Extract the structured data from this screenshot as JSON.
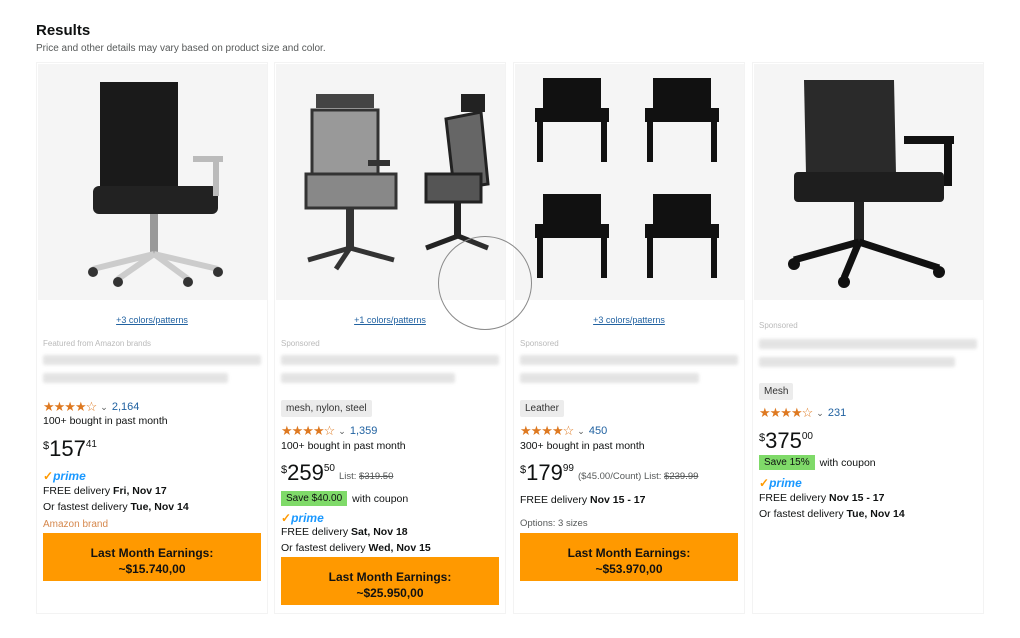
{
  "header": {
    "title": "Results",
    "subtitle": "Price and other details may vary based on product size and color."
  },
  "products": [
    {
      "image_icon": "office-chair-image",
      "colors_link": "+3 colors/patterns",
      "sponsored": "Featured from Amazon brands",
      "stars": "★★★★☆",
      "rating_count": "2,164",
      "bought": "100+ bought in past month",
      "price_symbol": "$",
      "price_whole": "157",
      "price_fraction": "41",
      "prime": "prime",
      "delivery_line1_prefix": "FREE delivery ",
      "delivery_line1_date": "Fri, Nov 17",
      "delivery_line2_prefix": "Or fastest delivery ",
      "delivery_line2_date": "Tue, Nov 14",
      "brand_note": "Amazon brand",
      "earnings_label": "Last Month Earnings:",
      "earnings_value": "~$15.740,00"
    },
    {
      "image_icon": "mesh-chair-image",
      "colors_link": "+1 colors/patterns",
      "sponsored": "Sponsored",
      "material": "mesh, nylon, steel",
      "stars": "★★★★☆",
      "rating_count": "1,359",
      "bought": "100+ bought in past month",
      "price_symbol": "$",
      "price_whole": "259",
      "price_fraction": "50",
      "list_label": "List: ",
      "list_price": "$319.50",
      "coupon_badge": "Save $40.00",
      "coupon_text": "with coupon",
      "prime": "prime",
      "delivery_line1_prefix": "FREE delivery ",
      "delivery_line1_date": "Sat, Nov 18",
      "delivery_line2_prefix": "Or fastest delivery ",
      "delivery_line2_date": "Wed, Nov 15",
      "earnings_label": "Last Month Earnings:",
      "earnings_value": "~$25.950,00"
    },
    {
      "image_icon": "four-chairs-image",
      "colors_link": "+3 colors/patterns",
      "sponsored": "Sponsored",
      "material": "Leather",
      "stars": "★★★★☆",
      "rating_count": "450",
      "bought": "300+ bought in past month",
      "price_symbol": "$",
      "price_whole": "179",
      "price_fraction": "99",
      "unit_price": "($45.00/Count)",
      "list_label": "List: ",
      "list_price": "$239.99",
      "delivery_line1_prefix": "FREE delivery ",
      "delivery_line1_date": "Nov 15 - 17",
      "options": "Options: 3 sizes",
      "earnings_label": "Last Month Earnings:",
      "earnings_value": "~$53.970,00"
    },
    {
      "image_icon": "task-chair-image",
      "sponsored": "Sponsored",
      "material": "Mesh",
      "stars": "★★★★☆",
      "rating_count": "231",
      "price_symbol": "$",
      "price_whole": "375",
      "price_fraction": "00",
      "coupon_badge": "Save 15%",
      "coupon_text": "with coupon",
      "prime": "prime",
      "delivery_line1_prefix": "FREE delivery ",
      "delivery_line1_date": "Nov 15 - 17",
      "delivery_line2_prefix": "Or fastest delivery ",
      "delivery_line2_date": "Tue, Nov 14"
    }
  ],
  "colors": {
    "button": "#ff9900",
    "link": "#2162a1",
    "stars": "#de7921",
    "coupon": "#7fda69",
    "prime": "#1a98ff"
  }
}
